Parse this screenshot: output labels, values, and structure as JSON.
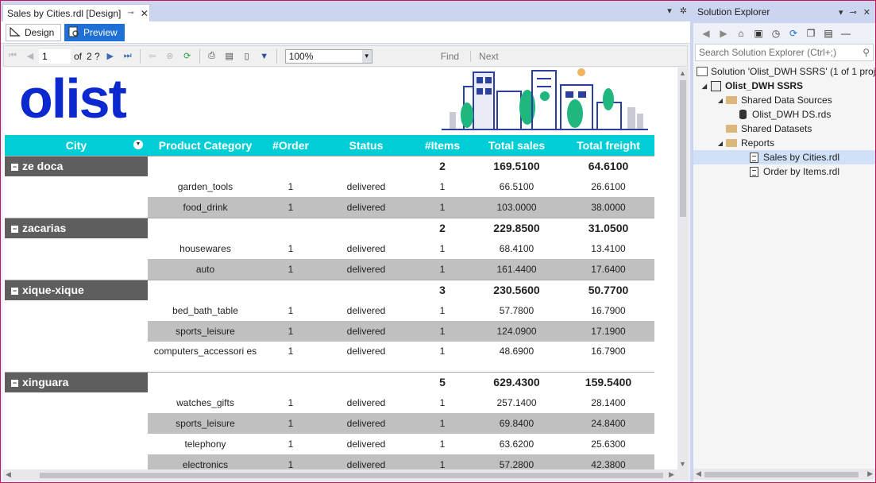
{
  "document": {
    "tab_title": "Sales by Cities.rdl [Design]",
    "pin_icon": "pin-icon",
    "close_icon": "close-icon",
    "design_tab": "Design",
    "preview_tab": "Preview"
  },
  "toolbar": {
    "page": "1",
    "of_label": "of",
    "total_pages": "2 ?",
    "zoom": "100%",
    "find": "Find",
    "next": "Next"
  },
  "report": {
    "logo": "olist",
    "headers": [
      "City",
      "Product Category",
      "#Order",
      "Status",
      "#Items",
      "Total sales",
      "Total freight"
    ],
    "groups": [
      {
        "city": "ze doca",
        "items": "2",
        "sales": "169.5100",
        "freight": "64.6100",
        "rows": [
          {
            "category": "garden_tools",
            "order": "1",
            "status": "delivered",
            "items": "1",
            "sales": "66.5100",
            "freight": "26.6100"
          },
          {
            "category": "food_drink",
            "order": "1",
            "status": "delivered",
            "items": "1",
            "sales": "103.0000",
            "freight": "38.0000"
          }
        ]
      },
      {
        "city": "zacarias",
        "items": "2",
        "sales": "229.8500",
        "freight": "31.0500",
        "rows": [
          {
            "category": "housewares",
            "order": "1",
            "status": "delivered",
            "items": "1",
            "sales": "68.4100",
            "freight": "13.4100"
          },
          {
            "category": "auto",
            "order": "1",
            "status": "delivered",
            "items": "1",
            "sales": "161.4400",
            "freight": "17.6400"
          }
        ]
      },
      {
        "city": "xique-xique",
        "items": "3",
        "sales": "230.5600",
        "freight": "50.7700",
        "rows": [
          {
            "category": "bed_bath_table",
            "order": "1",
            "status": "delivered",
            "items": "1",
            "sales": "57.7800",
            "freight": "16.7900"
          },
          {
            "category": "sports_leisure",
            "order": "1",
            "status": "delivered",
            "items": "1",
            "sales": "124.0900",
            "freight": "17.1900"
          },
          {
            "category": "computers_accessori es",
            "order": "1",
            "status": "delivered",
            "items": "1",
            "sales": "48.6900",
            "freight": "16.7900"
          }
        ]
      },
      {
        "city": "xinguara",
        "items": "5",
        "sales": "629.4300",
        "freight": "159.5400",
        "rows": [
          {
            "category": "watches_gifts",
            "order": "1",
            "status": "delivered",
            "items": "1",
            "sales": "257.1400",
            "freight": "28.1400"
          },
          {
            "category": "sports_leisure",
            "order": "1",
            "status": "delivered",
            "items": "1",
            "sales": "69.8400",
            "freight": "24.8400"
          },
          {
            "category": "telephony",
            "order": "1",
            "status": "delivered",
            "items": "1",
            "sales": "63.6200",
            "freight": "25.6300"
          },
          {
            "category": "electronics",
            "order": "1",
            "status": "delivered",
            "items": "1",
            "sales": "57.2800",
            "freight": "42.3800"
          }
        ]
      }
    ]
  },
  "solution_explorer": {
    "title": "Solution Explorer",
    "search_placeholder": "Search Solution Explorer (Ctrl+;)",
    "solution": "Solution 'Olist_DWH SSRS' (1 of 1 project)",
    "project": "Olist_DWH SSRS",
    "shared_data_sources": "Shared Data Sources",
    "data_source": "Olist_DWH DS.rds",
    "shared_datasets": "Shared Datasets",
    "reports": "Reports",
    "report_1": "Sales by Cities.rdl",
    "report_2": "Order by Items.rdl"
  },
  "colors": {
    "header_teal": "#00cdd6",
    "group_dark": "#5e5e5e",
    "row_shade": "#c0c0c0",
    "logo_blue": "#0c29d0",
    "preview_blue": "#1e6fd6",
    "frame": "#c2185b"
  }
}
